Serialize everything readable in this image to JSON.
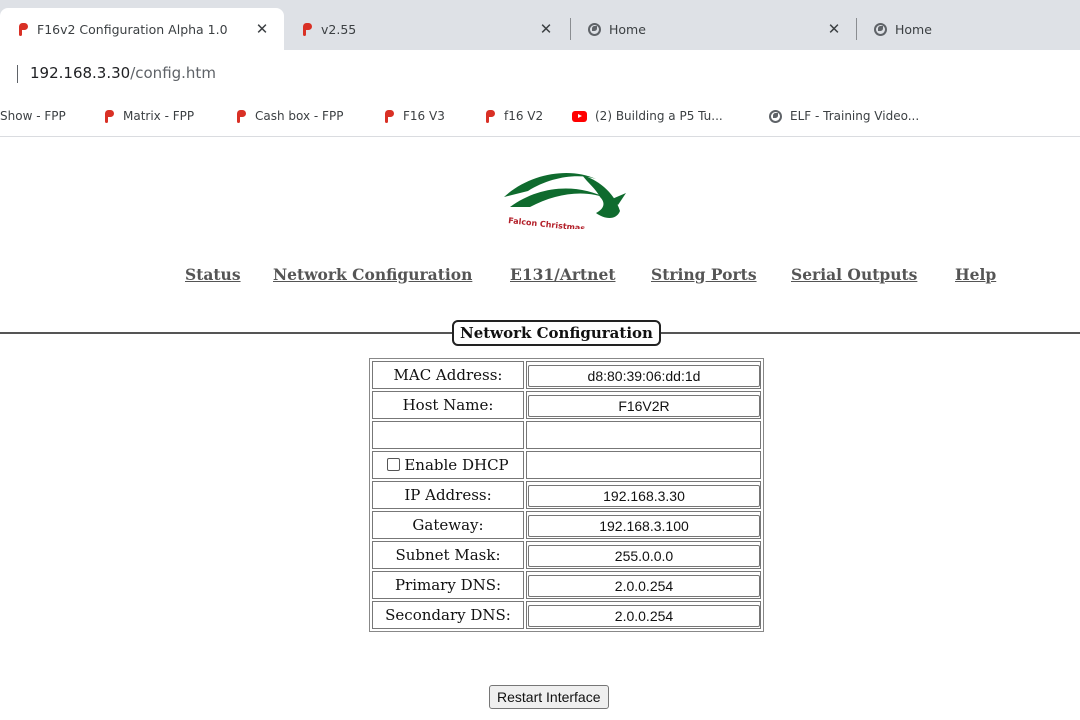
{
  "tabs": [
    {
      "title": "F16v2 Configuration Alpha 1.0",
      "icon": "falcon-icon",
      "active": true
    },
    {
      "title": "v2.55",
      "icon": "falcon-icon",
      "active": false
    },
    {
      "title": "Home",
      "icon": "globe-icon",
      "active": false
    },
    {
      "title": "Home",
      "icon": "globe-icon",
      "active": false
    }
  ],
  "tab_close_glyph": "✕",
  "address": {
    "host": "192.168.3.30",
    "path": "/config.htm"
  },
  "bookmarks": [
    {
      "label": "Show - FPP",
      "icon": "falcon-icon"
    },
    {
      "label": "Matrix - FPP",
      "icon": "falcon-icon"
    },
    {
      "label": "Cash box - FPP",
      "icon": "falcon-icon"
    },
    {
      "label": "F16 V3",
      "icon": "falcon-icon"
    },
    {
      "label": "f16 V2",
      "icon": "falcon-icon"
    },
    {
      "label": "(2) Building a P5 Tu...",
      "icon": "youtube-icon"
    },
    {
      "label": "ELF - Training Video...",
      "icon": "globe-icon"
    }
  ],
  "logo": {
    "text": "Falcon Christmas",
    "color": "#0f6b2e",
    "text_color": "#b3202a"
  },
  "nav": {
    "status": "Status",
    "network": "Network Configuration",
    "e131": "E131/Artnet",
    "string_ports": "String Ports",
    "serial_outputs": "Serial Outputs",
    "help": "Help"
  },
  "section_title": "Network Configuration",
  "fields": {
    "mac": {
      "label": "MAC Address:",
      "value": "d8:80:39:06:dd:1d"
    },
    "host": {
      "label": "Host Name:",
      "value": "F16V2R"
    },
    "dhcp": {
      "label": "Enable DHCP",
      "checked": false
    },
    "ip": {
      "label": "IP Address:",
      "value": "192.168.3.30"
    },
    "gateway": {
      "label": "Gateway:",
      "value": "192.168.3.100"
    },
    "subnet": {
      "label": "Subnet Mask:",
      "value": "255.0.0.0"
    },
    "dns1": {
      "label": "Primary DNS:",
      "value": "2.0.0.254"
    },
    "dns2": {
      "label": "Secondary DNS:",
      "value": "2.0.0.254"
    }
  },
  "restart_label": "Restart Interface"
}
